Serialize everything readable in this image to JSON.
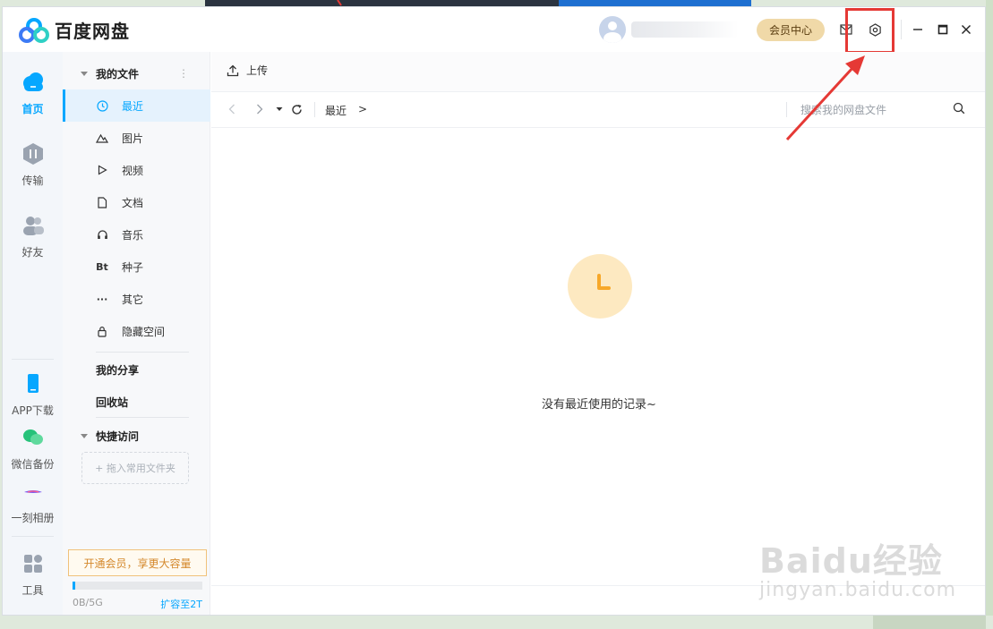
{
  "app": {
    "title": "百度网盘"
  },
  "header": {
    "vip_label": "会员中心"
  },
  "rail": {
    "items": [
      {
        "label": "首页"
      },
      {
        "label": "传输"
      },
      {
        "label": "好友"
      },
      {
        "label": "APP下载"
      },
      {
        "label": "微信备份"
      },
      {
        "label": "一刻相册"
      },
      {
        "label": "工具"
      }
    ]
  },
  "sidebar": {
    "my_files": "我的文件",
    "items": [
      {
        "label": "最近",
        "icon": "clock-icon"
      },
      {
        "label": "图片",
        "icon": "image-icon"
      },
      {
        "label": "视频",
        "icon": "play-icon"
      },
      {
        "label": "文档",
        "icon": "document-icon"
      },
      {
        "label": "音乐",
        "icon": "headphones-icon"
      },
      {
        "label": "种子",
        "icon": "bt-icon"
      },
      {
        "label": "其它",
        "icon": "more-icon"
      },
      {
        "label": "隐藏空间",
        "icon": "lock-icon"
      }
    ],
    "bt_glyph": "Bt",
    "more_glyph": "···",
    "my_share": "我的分享",
    "recycle": "回收站",
    "quick_access": "快捷访问",
    "drop_hint": "+ 拖入常用文件夹",
    "promo": "开通会员，享更大容量",
    "quota_used": "0B/5G",
    "quota_upgrade": "扩容至2T",
    "quota_fraction": 0.01
  },
  "main": {
    "upload_label": "上传",
    "breadcrumb": "最近",
    "breadcrumb_arrow": ">",
    "search_placeholder": "搜索我的网盘文件",
    "empty_text": "没有最近使用的记录~"
  },
  "watermark": {
    "brand": "Baidu经验",
    "url": "jingyan.baidu.com"
  },
  "colors": {
    "accent": "#06a7ff",
    "vip_bg": "#f0d9a8",
    "annotation": "#e53935"
  }
}
